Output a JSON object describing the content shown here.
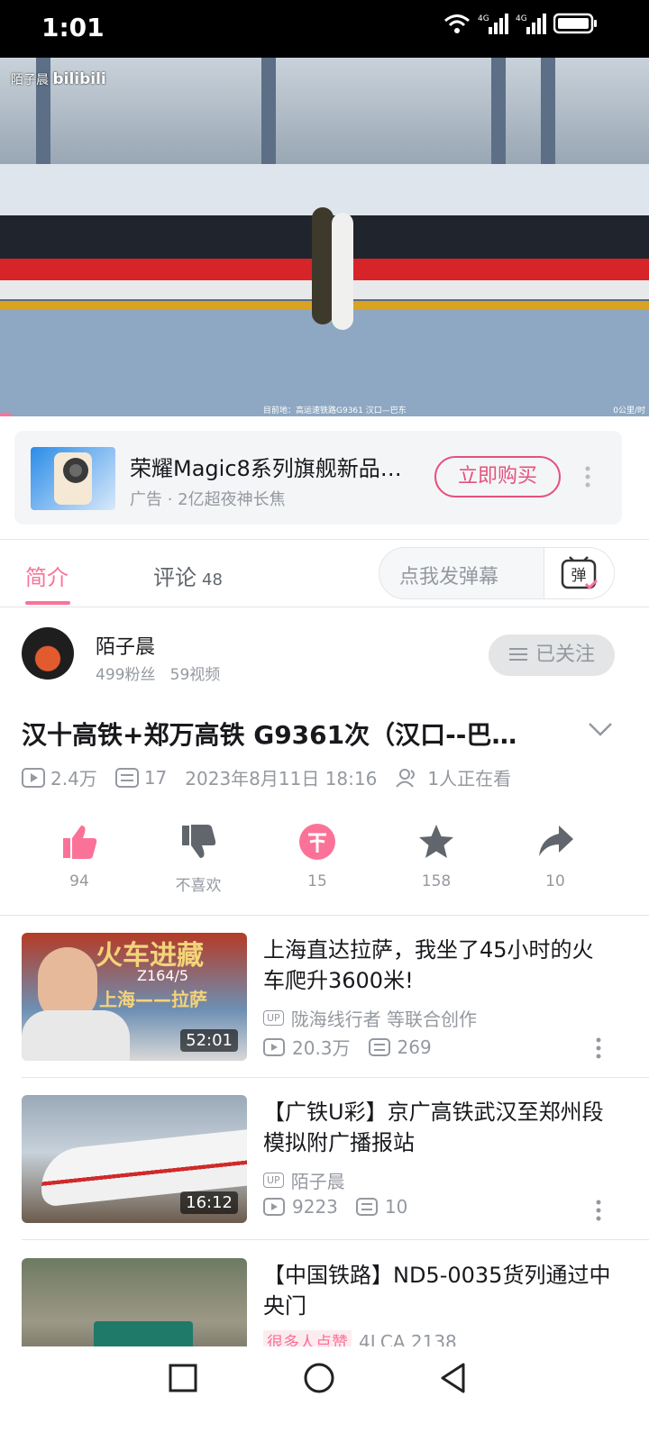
{
  "status_bar": {
    "time": "1:01",
    "network_1": "4G",
    "network_2": "4G"
  },
  "video": {
    "watermark_name": "陌子晨",
    "watermark_brand": "bilibili",
    "caption": "目前地：高运速铁路G9361 汉口—巴东",
    "caption_right": "0公里/时"
  },
  "ad": {
    "title": "荣耀Magic8系列旗舰新品…",
    "subtitle": "广告 · 2亿超夜神长焦",
    "buy_label": "立即购买"
  },
  "tabs": {
    "intro": "简介",
    "comments": "评论",
    "comments_count": "48",
    "danmu_placeholder": "点我发弹幕",
    "danmu_icon_label": "弹"
  },
  "uploader": {
    "name": "陌子晨",
    "fans": "499粉丝",
    "videos": "59视频",
    "follow_label": "已关注"
  },
  "video_info": {
    "title": "汉十高铁+郑万高铁 G9361次（汉口--巴…",
    "views": "2.4万",
    "danmaku": "17",
    "date": "2023年8月11日 18:16",
    "watching": "1人正在看"
  },
  "actions": {
    "like": "94",
    "dislike": "不喜欢",
    "coin": "15",
    "favorite": "158",
    "share": "10"
  },
  "recommendations": [
    {
      "title": "上海直达拉萨，我坐了45小时的火车爬升3600米!",
      "uploader": "陇海线行者 等联合创作",
      "views": "20.3万",
      "danmaku": "269",
      "duration": "52:01",
      "thumb_text_1": "火车进藏",
      "thumb_text_2": "Z164/5",
      "thumb_text_3": "上海——拉萨"
    },
    {
      "title": "【广铁U彩】京广高铁武汉至郑州段模拟附广播报站",
      "uploader": "陌子晨",
      "views": "9223",
      "danmaku": "10",
      "duration": "16:12"
    },
    {
      "title": "【中国铁路】ND5-0035货列通过中央门",
      "badge": "很多人点赞",
      "partial_meta": "4LCA 2138"
    }
  ],
  "up_tag": "UP",
  "colors": {
    "accent": "#fb7299",
    "ad_button": "#e4527d",
    "secondary_text": "#9499a0"
  }
}
